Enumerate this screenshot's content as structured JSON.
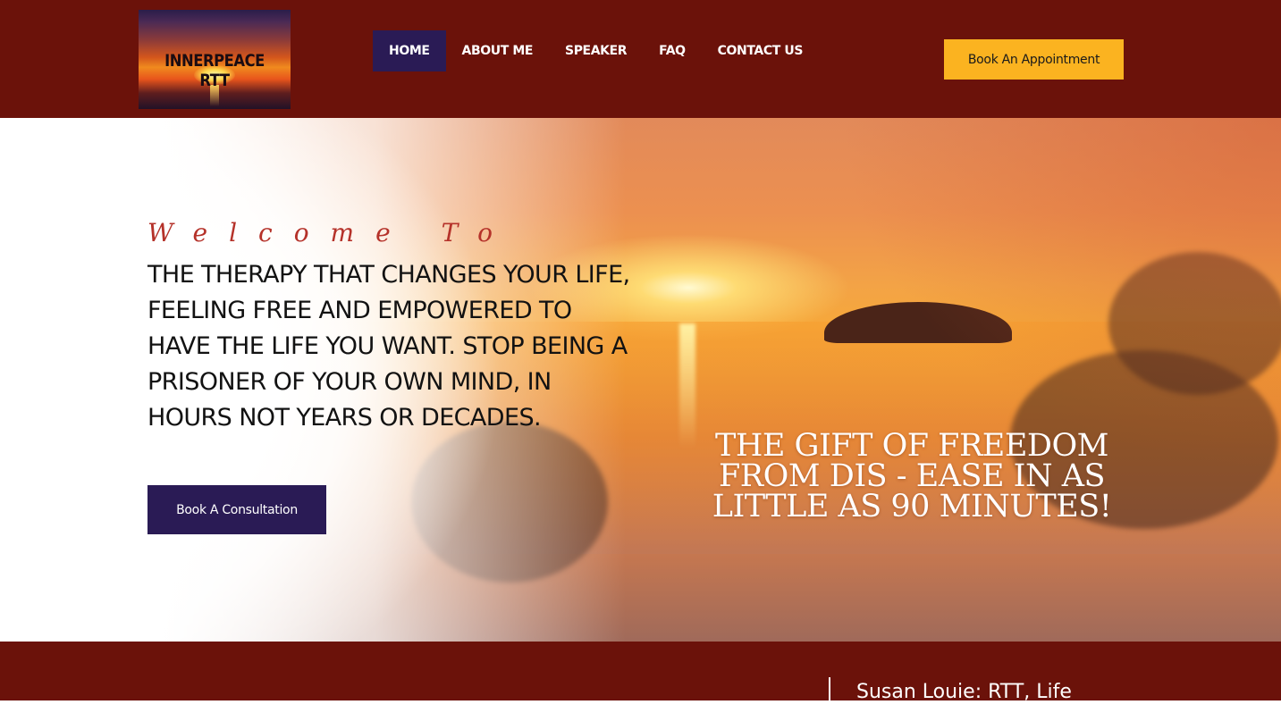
{
  "header": {
    "logo_text": "INNERPEACE RTT",
    "nav": [
      {
        "label": "HOME",
        "active": true
      },
      {
        "label": "ABOUT ME",
        "active": false
      },
      {
        "label": "SPEAKER",
        "active": false
      },
      {
        "label": "FAQ",
        "active": false
      },
      {
        "label": "CONTACT US",
        "active": false
      }
    ],
    "cta_label": "Book An Appointment"
  },
  "hero": {
    "welcome": "Welcome To",
    "headline": "THE THERAPY THAT CHANGES YOUR LIFE, FEELING FREE AND EMPOWERED TO HAVE THE LIFE YOU WANT. STOP BEING A PRISONER OF YOUR OWN MIND, IN HOURS NOT YEARS OR DECADES.",
    "button_label": "Book A Consultation",
    "tagline": "THE GIFT OF FREEDOM FROM DIS - EASE IN AS LITTLE AS 90 MINUTES!"
  },
  "footer": {
    "title": "Susan Louie: RTT, Life"
  },
  "colors": {
    "brand_dark_red": "#6b120a",
    "nav_active": "#2a1b55",
    "cta_yellow": "#fbb320",
    "accent_script": "#b5322a"
  }
}
